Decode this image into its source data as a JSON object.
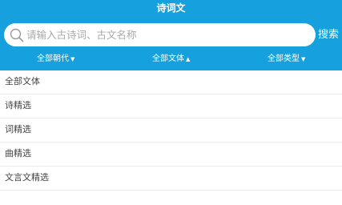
{
  "header": {
    "title": "诗词文",
    "background_color": "#16a0dd"
  },
  "search": {
    "placeholder": "请输入古诗词、古文名称",
    "button_label": "搜索"
  },
  "filters": [
    {
      "label": "全部朝代",
      "caret": "▼"
    },
    {
      "label": "全部文体",
      "caret": "▲"
    },
    {
      "label": "全部类型",
      "caret": "▼"
    }
  ],
  "genre_options": [
    {
      "label": "全部文体"
    },
    {
      "label": "诗精选"
    },
    {
      "label": "词精选"
    },
    {
      "label": "曲精选"
    },
    {
      "label": "文言文精选"
    }
  ]
}
